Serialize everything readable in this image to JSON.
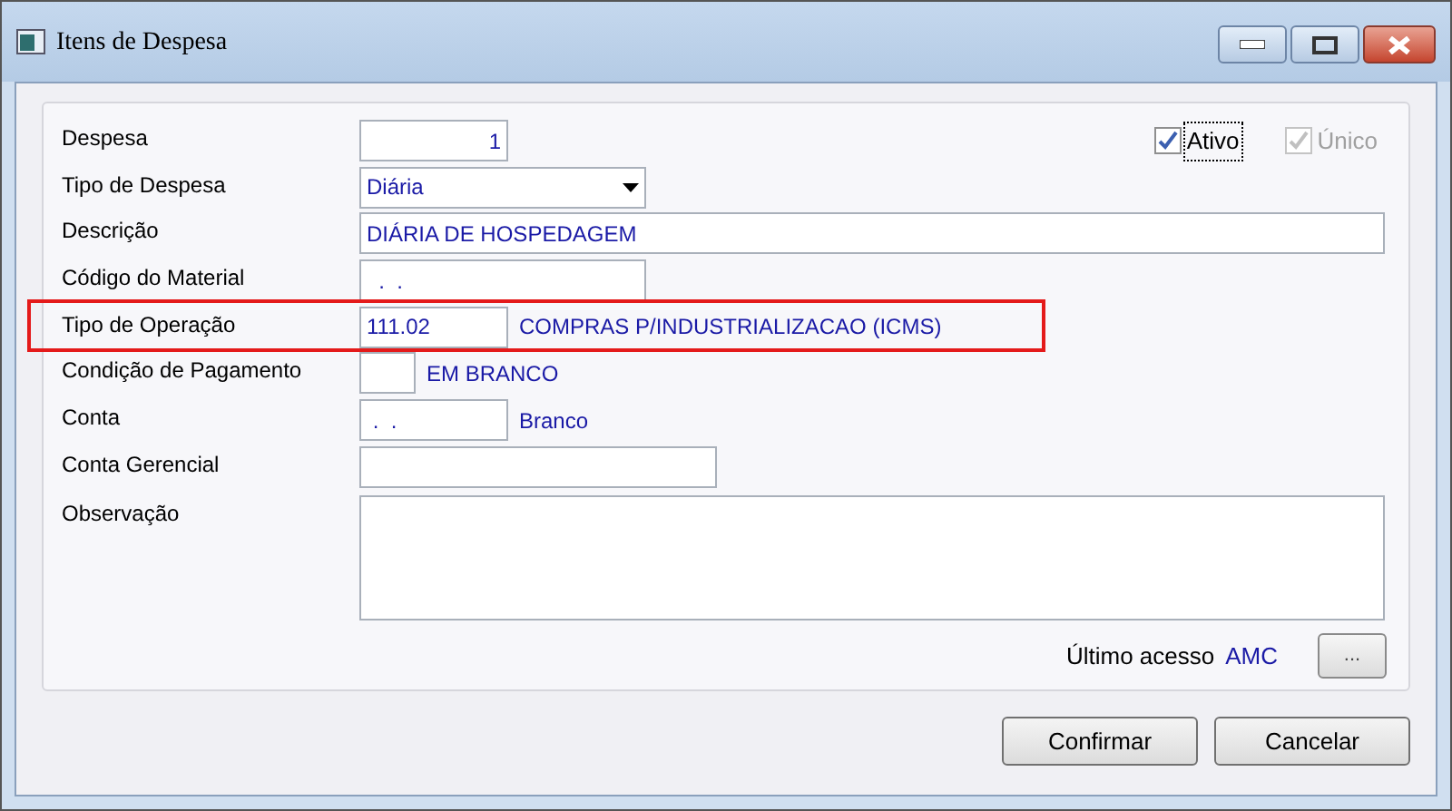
{
  "window": {
    "title": "Itens de Despesa"
  },
  "checkboxes": [
    {
      "label": "Ativo",
      "checked": true,
      "disabled": false,
      "focused": true
    },
    {
      "label": "Único",
      "checked": true,
      "disabled": true,
      "focused": false
    }
  ],
  "rows": [
    {
      "label": "Despesa",
      "kind": "number",
      "value": "1",
      "highlighted": false
    },
    {
      "label": "Tipo de Despesa",
      "kind": "select",
      "value": "Diária",
      "highlighted": false
    },
    {
      "label": "Descrição",
      "kind": "input",
      "value": "DIÁRIA DE HOSPEDAGEM",
      "highlighted": false
    },
    {
      "label": "Código do Material",
      "kind": "input",
      "value": "  .  .",
      "highlighted": false
    },
    {
      "label": "Tipo de Operação",
      "kind": "input",
      "value": "111.02",
      "description": "COMPRAS P/INDUSTRIALIZACAO (ICMS)",
      "highlighted": true
    },
    {
      "label": "Condição de Pagamento",
      "kind": "input",
      "value": "",
      "description": "EM BRANCO",
      "highlighted": false
    },
    {
      "label": "Conta",
      "kind": "input",
      "value": " .  .",
      "description": "Branco",
      "highlighted": false
    },
    {
      "label": "Conta Gerencial",
      "kind": "input",
      "value": "",
      "highlighted": false
    },
    {
      "label": "Observação",
      "kind": "textarea",
      "value": "",
      "highlighted": false
    }
  ],
  "last_access": {
    "label": "Último acesso",
    "value": "AMC",
    "button": "..."
  },
  "buttons": [
    {
      "label": "Confirmar"
    },
    {
      "label": "Cancelar"
    }
  ]
}
